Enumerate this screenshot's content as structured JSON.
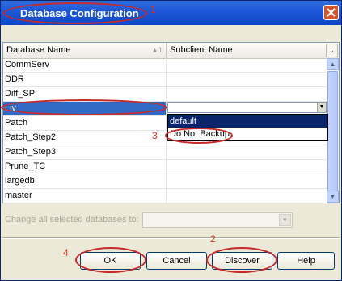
{
  "dialog": {
    "title": "Database Configuration"
  },
  "grid": {
    "columns": [
      "Database Name",
      "Subclient Name"
    ],
    "sort_indicator": "▲1",
    "rows": [
      {
        "database": "CommServ",
        "subclient": ""
      },
      {
        "database": "DDR",
        "subclient": ""
      },
      {
        "database": "Diff_SP",
        "subclient": ""
      },
      {
        "database": "Liv",
        "subclient": "",
        "selected": true
      },
      {
        "database": "Patch",
        "subclient": ""
      },
      {
        "database": "Patch_Step2",
        "subclient": ""
      },
      {
        "database": "Patch_Step3",
        "subclient": ""
      },
      {
        "database": "Prune_TC",
        "subclient": ""
      },
      {
        "database": "largedb",
        "subclient": ""
      },
      {
        "database": "master",
        "subclient": ""
      }
    ]
  },
  "subclient_dropdown": {
    "value": "",
    "options": [
      "default",
      "Do Not Backup"
    ],
    "highlighted": "default"
  },
  "change_all": {
    "label": "Change all selected databases to:",
    "value": ""
  },
  "buttons": {
    "ok": "OK",
    "cancel": "Cancel",
    "discover": "Discover",
    "help": "Help"
  },
  "annotations": [
    "1",
    "2",
    "3",
    "4"
  ],
  "colors": {
    "title_bar": "#0b47c4",
    "selection": "#316ac5",
    "annotation": "#c62a2a"
  }
}
